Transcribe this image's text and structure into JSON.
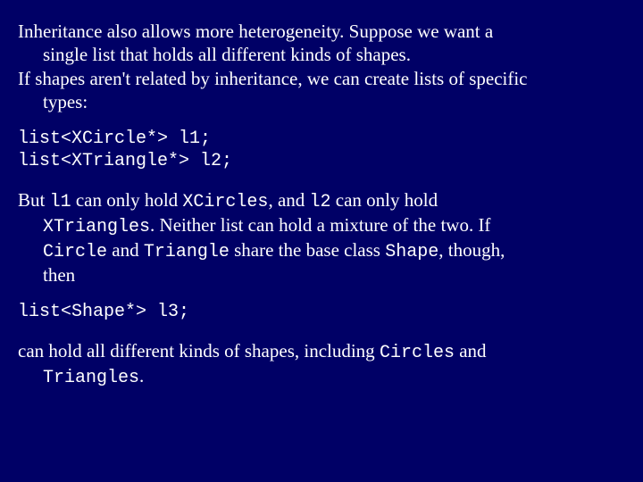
{
  "para1_a": "Inheritance also allows more heterogeneity.  Suppose we want a",
  "para1_b": "single list that holds all different kinds of shapes.",
  "para2_a": "If shapes aren't related by inheritance, we can create lists of specific",
  "para2_b": "types:",
  "code1_l1": "list<XCircle*> l1;",
  "code1_l2": "list<XTriangle*> l2;",
  "but": "But ",
  "l1": "l1",
  "p3_1": " can only hold ",
  "xcircles": "XCircles",
  "p3_2": ", and ",
  "l2": "l2",
  "p3_3": " can only hold",
  "xtriangles": "XTriangles",
  "p3_4": ".  Neither list can hold a mixture of the two.  If",
  "circle": "Circle",
  "p3_5": " and ",
  "triangle": "Triangle",
  "p3_6": " share the base class ",
  "shape": "Shape",
  "p3_7": ", though,",
  "p3_8": "then",
  "code2": "list<Shape*> l3;",
  "p4_1": "can hold all different kinds of shapes, including ",
  "circles": "Circles",
  "p4_2": " and",
  "triangles": "Triangles",
  "p4_3": "."
}
